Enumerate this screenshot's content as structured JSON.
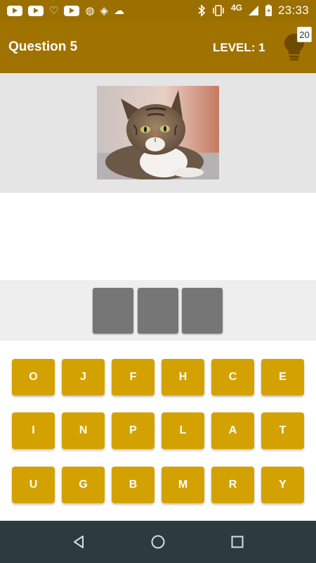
{
  "status_bar": {
    "time": "23:33",
    "network": "4G",
    "notification_icons": [
      "youtube-icon",
      "youtube-icon",
      "heart-icon",
      "youtube-icon",
      "circle-icon",
      "diamond-icon",
      "cloud-icon"
    ],
    "system_icons": [
      "bluetooth-icon",
      "vibrate-icon",
      "signal-icon",
      "battery-icon"
    ]
  },
  "app_bar": {
    "title": "Question 5",
    "level": "LEVEL: 1",
    "hint_count": "20",
    "hint_icon": "lightbulb-icon"
  },
  "question": {
    "image": "cat-photo",
    "answer_slots": 3
  },
  "keyboard": {
    "rows": [
      [
        "O",
        "J",
        "F",
        "H",
        "C",
        "E"
      ],
      [
        "I",
        "N",
        "P",
        "L",
        "A",
        "T"
      ],
      [
        "U",
        "G",
        "B",
        "M",
        "R",
        "Y"
      ]
    ]
  },
  "nav_bar": {
    "buttons": [
      "back-icon",
      "home-icon",
      "recents-icon"
    ]
  },
  "colors": {
    "status_bar": "#9b6f00",
    "app_bar": "#a07200",
    "key": "#d4a200",
    "slot": "#767676",
    "nav_bar": "#2d3a3f"
  }
}
